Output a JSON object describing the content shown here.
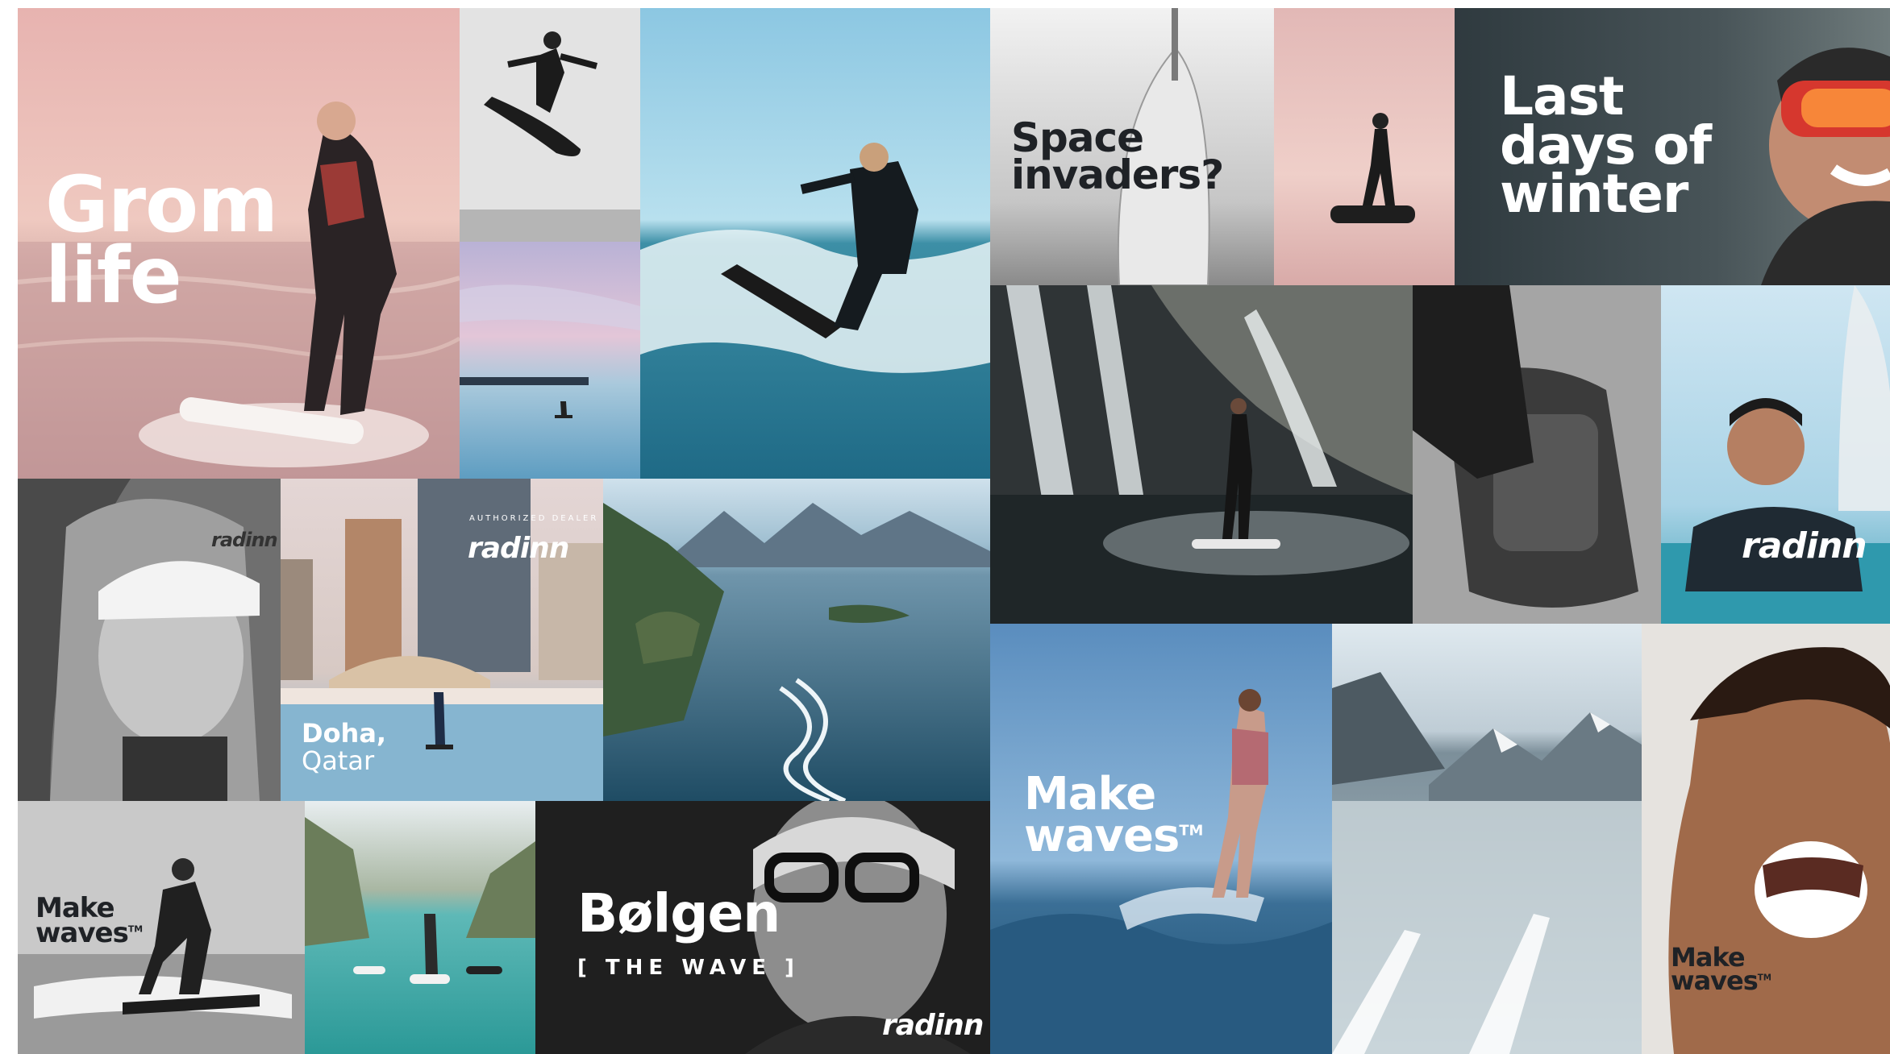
{
  "tiles": {
    "grom": {
      "line1": "Grom",
      "line2": "life"
    },
    "space": {
      "line1": "Space",
      "line2": "invaders?"
    },
    "winter": {
      "line1": "Last",
      "line2": "days of",
      "line3": "winter"
    },
    "doha": {
      "line1": "Doha,",
      "line2": "Qatar",
      "badge": "radinn",
      "badge_ring": "AUTHORIZED DEALER"
    },
    "make_center": {
      "line1": "Make",
      "line2": "waves",
      "tm": "TM"
    },
    "make_bw": {
      "line1": "Make",
      "line2": "waves",
      "tm": "TM"
    },
    "make_right": {
      "line1": "Make",
      "line2": "waves",
      "tm": "TM"
    },
    "bolgen": {
      "title": "Bølgen",
      "subtitle": "[ THE WAVE ]",
      "logo": "radinn"
    },
    "cap_logo": {
      "logo": "radinn"
    },
    "dubai_logo": {
      "logo": "radinn"
    }
  },
  "colors": {
    "brand_white": "#ffffff",
    "ink_dark": "#1f2226",
    "sea_blue": "#2f6f8f",
    "dusk_pink": "#e9b9b4"
  }
}
